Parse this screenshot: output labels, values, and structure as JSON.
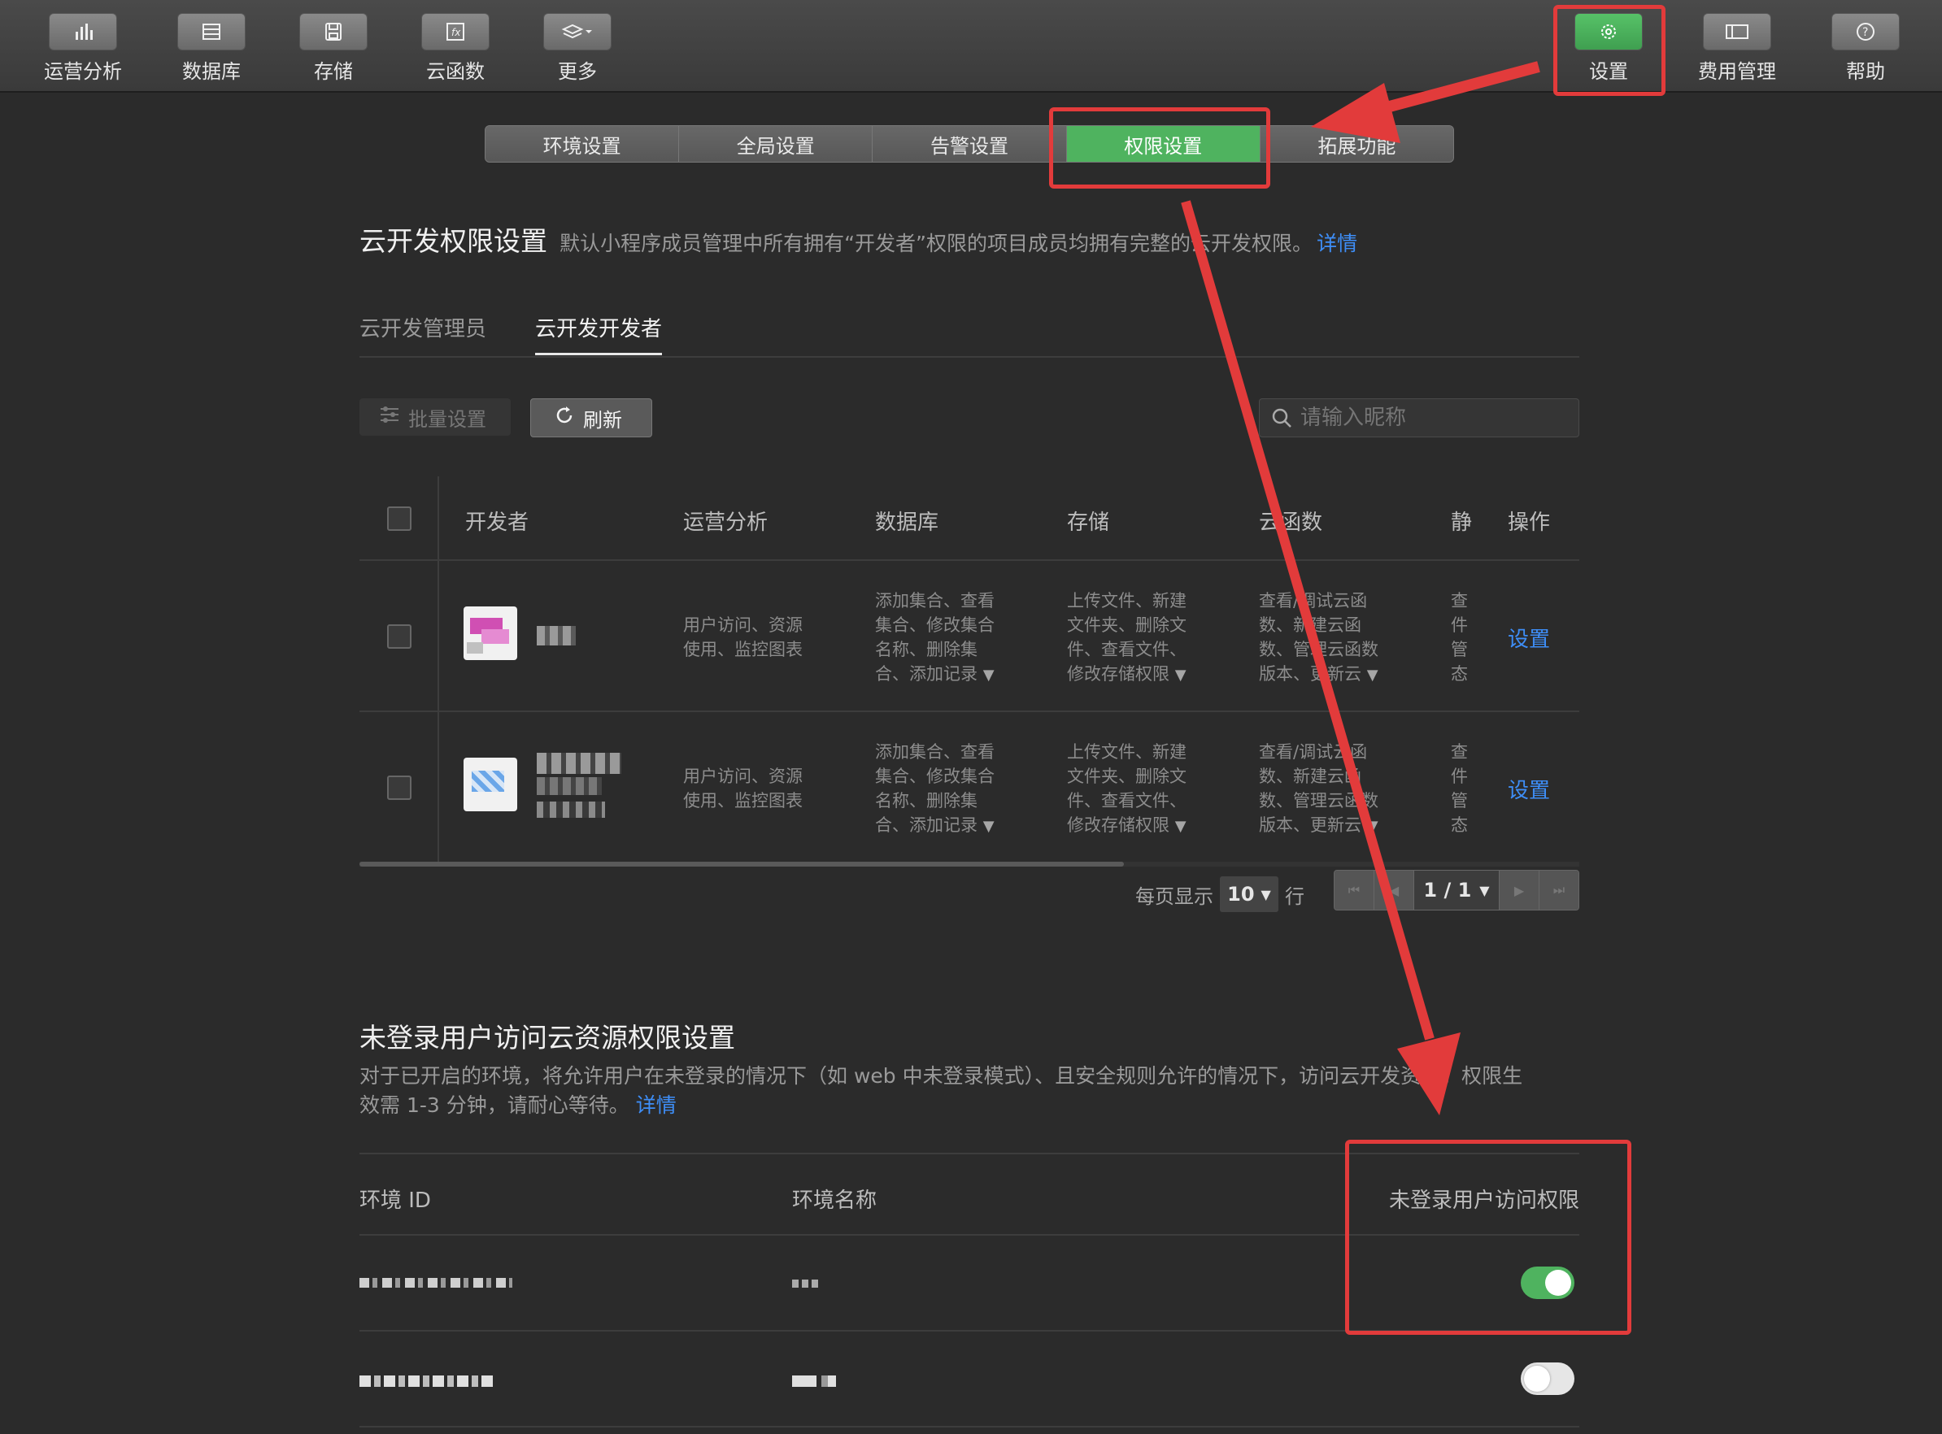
{
  "toolbar": {
    "items": [
      {
        "label": "运营分析",
        "icon": "bar-chart-icon"
      },
      {
        "label": "数据库",
        "icon": "database-icon"
      },
      {
        "label": "存储",
        "icon": "floppy-disk-icon"
      },
      {
        "label": "云函数",
        "icon": "function-icon"
      },
      {
        "label": "更多",
        "icon": "layers-icon"
      },
      {
        "label": "设置",
        "icon": "gear-icon",
        "active": true
      },
      {
        "label": "费用管理",
        "icon": "billing-icon"
      },
      {
        "label": "帮助",
        "icon": "help-icon"
      }
    ]
  },
  "tabs": {
    "items": [
      "环境设置",
      "全局设置",
      "告警设置",
      "权限设置",
      "拓展功能"
    ],
    "active": "权限设置"
  },
  "permissions": {
    "title": "云开发权限设置",
    "description": "默认小程序成员管理中所有拥有“开发者”权限的项目成员均拥有完整的云开发权限。",
    "details_link": "详情",
    "subtabs": [
      "云开发管理员",
      "云开发开发者"
    ],
    "active_subtab": "云开发开发者",
    "batch_button": "批量设置",
    "refresh_button": "刷新",
    "search_placeholder": "请输入昵称",
    "columns": [
      "开发者",
      "运营分析",
      "数据库",
      "存储",
      "云函数",
      "静",
      "操作"
    ],
    "rows": [
      {
        "analytics": [
          "用户访问、资源",
          "使用、监控图表"
        ],
        "database": [
          "添加集合、查看",
          "集合、修改集合",
          "名称、删除集",
          "合、添加记录"
        ],
        "storage": [
          "上传文件、新建",
          "文件夹、删除文",
          "件、查看文件、",
          "修改存储权限"
        ],
        "functions": [
          "查看/调试云函",
          "数、新建云函",
          "数、管理云函数",
          "版本、更新云"
        ],
        "static": [
          "查",
          "件",
          "管",
          "态"
        ],
        "action": "设置"
      },
      {
        "analytics": [
          "用户访问、资源",
          "使用、监控图表"
        ],
        "database": [
          "添加集合、查看",
          "集合、修改集合",
          "名称、删除集",
          "合、添加记录"
        ],
        "storage": [
          "上传文件、新建",
          "文件夹、删除文",
          "件、查看文件、",
          "修改存储权限"
        ],
        "functions": [
          "查看/调试云函",
          "数、新建云函",
          "数、管理云函数",
          "版本、更新云"
        ],
        "static": [
          "查",
          "件",
          "管",
          "态"
        ],
        "action": "设置"
      }
    ],
    "pagination": {
      "per_page_label": "每页显示",
      "per_page_value": "10",
      "row_unit": "行",
      "page": "1 / 1"
    }
  },
  "guest_access": {
    "title": "未登录用户访问云资源权限设置",
    "description_line1": "对于已开启的环境，将允许用户在未登录的情况下（如 web 中未登录模式）、且安全规则允许的情况下，访问云开发资源。权限生",
    "description_line2": "效需 1-3 分钟，请耐心等待。",
    "details_link": "详情",
    "columns": [
      "环境 ID",
      "环境名称",
      "未登录用户访问权限"
    ],
    "rows": [
      {
        "enabled": true
      },
      {
        "enabled": false
      }
    ]
  },
  "colors": {
    "accent_green": "#4fb35f",
    "link_blue": "#3e8ef7",
    "annotation_red": "#e23b3b",
    "background": "#2b2b2b"
  }
}
